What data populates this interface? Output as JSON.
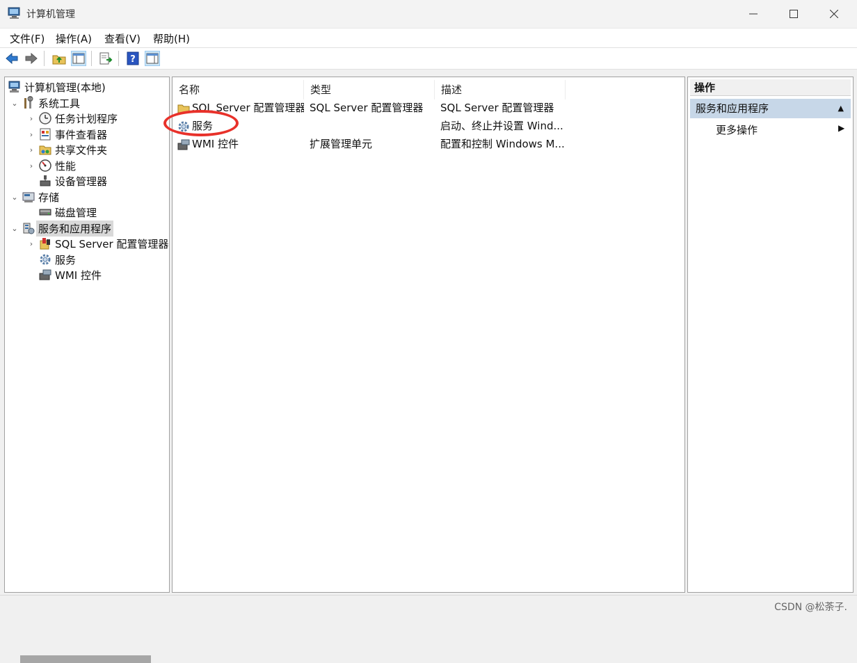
{
  "window": {
    "title": "计算机管理",
    "minimize_glyph": "—",
    "maximize_glyph": "☐",
    "close_glyph": "✕"
  },
  "menu": [
    "文件(F)",
    "操作(A)",
    "查看(V)",
    "帮助(H)"
  ],
  "toolbar": {
    "buttons": [
      "back-arrow-icon",
      "forward-arrow-icon",
      "up-folder-icon",
      "show-hide-tree-icon",
      "export-list-icon",
      "help-icon",
      "show-hide-action-pane-icon"
    ]
  },
  "tree": {
    "items": [
      {
        "label": "计算机管理(本地)",
        "icon": "computer-management-icon",
        "caret": ""
      },
      {
        "label": "系统工具",
        "icon": "system-tools-icon",
        "caret": "⌄"
      },
      {
        "label": "任务计划程序",
        "icon": "clock-icon",
        "caret": "›"
      },
      {
        "label": "事件查看器",
        "icon": "event-viewer-icon",
        "caret": "›"
      },
      {
        "label": "共享文件夹",
        "icon": "shared-folder-icon",
        "caret": "›"
      },
      {
        "label": "性能",
        "icon": "performance-icon",
        "caret": "›"
      },
      {
        "label": "设备管理器",
        "icon": "device-manager-icon",
        "caret": ""
      },
      {
        "label": "存储",
        "icon": "storage-icon",
        "caret": "⌄"
      },
      {
        "label": "磁盘管理",
        "icon": "disk-icon",
        "caret": ""
      },
      {
        "label": "服务和应用程序",
        "icon": "services-apps-icon",
        "caret": "⌄"
      },
      {
        "label": "SQL Server 配置管理器",
        "icon": "sql-server-icon",
        "caret": "›"
      },
      {
        "label": "服务",
        "icon": "gear-icon",
        "caret": ""
      },
      {
        "label": "WMI 控件",
        "icon": "wmi-icon",
        "caret": ""
      }
    ]
  },
  "list": {
    "columns": [
      "名称",
      "类型",
      "描述"
    ],
    "rows": [
      {
        "name": "SQL Server 配置管理器",
        "type": "SQL Server 配置管理器",
        "desc": "SQL Server 配置管理器",
        "icon": "folder-icon"
      },
      {
        "name": "服务",
        "type": "",
        "desc": "启动、终止并设置 Wind...",
        "icon": "gear-icon"
      },
      {
        "name": "WMI 控件",
        "type": "扩展管理单元",
        "desc": "配置和控制 Windows M...",
        "icon": "wmi-icon"
      }
    ]
  },
  "actions": {
    "header": "操作",
    "section": "服务和应用程序",
    "section_arrow": "▲",
    "more": "更多操作",
    "more_arrow": "▶"
  },
  "status": {
    "watermark": "CSDN @松荼子."
  },
  "colors": {
    "annotation": "#e8312a",
    "selected_section": "#c7d7e8"
  }
}
